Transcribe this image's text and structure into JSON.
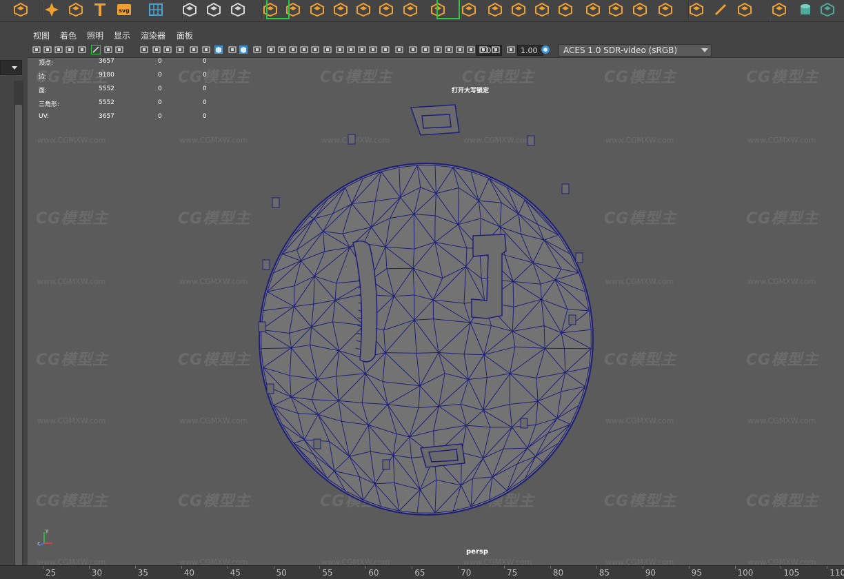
{
  "panel_menu": [
    "视图",
    "着色",
    "照明",
    "显示",
    "渲染器",
    "面板"
  ],
  "toolbar": {
    "exposure_value": "0.00",
    "gamma_value": "1.00",
    "color_space": "ACES 1.0 SDR-video (sRGB)"
  },
  "shelf_icons": [
    "polygon-sphere-icon",
    "sweep-star-icon",
    "helix-icon",
    "type-text-icon",
    "svg-icon",
    "grid-icon",
    "measure-icon",
    "align-icon",
    "snap-coords-icon",
    "sculpt-icon",
    "layers-icon",
    "combine-icon",
    "separate-icon",
    "extract-icon",
    "smooth-icon",
    "boolean-icon",
    "mirror-icon",
    "bevel-icon",
    "extrude-icon",
    "bridge-icon",
    "fill-hole-icon",
    "merge-icon",
    "split-icon",
    "multi-cut-icon",
    "target-weld-icon",
    "edge-loop-icon",
    "uv-icon",
    "pencil-icon",
    "crease-icon",
    "paint-icon",
    "cylinder-icon",
    "cube-icon"
  ],
  "hud": {
    "rows": [
      {
        "label": "顶点:",
        "v1": "3657",
        "v2": "0",
        "v3": "0"
      },
      {
        "label": "边:",
        "v1": "9180",
        "v2": "0",
        "v3": "0"
      },
      {
        "label": "面:",
        "v1": "5552",
        "v2": "0",
        "v3": "0"
      },
      {
        "label": "三角形:",
        "v1": "5552",
        "v2": "0",
        "v3": "0"
      },
      {
        "label": "UV:",
        "v1": "3657",
        "v2": "0",
        "v3": "0"
      }
    ],
    "caps_lock_message": "打开大写锁定",
    "camera": "persp"
  },
  "axis": {
    "y": "y",
    "x": "x",
    "z": "z"
  },
  "watermark": {
    "logo": "CG模型主",
    "url": "www.CGMXW.com"
  },
  "timeline": {
    "ticks": [
      "25",
      "30",
      "35",
      "40",
      "45",
      "50",
      "55",
      "60",
      "65",
      "70",
      "75",
      "80",
      "85",
      "90",
      "95",
      "100",
      "105",
      "110"
    ]
  },
  "colors": {
    "wireframe": "#1f1f7a",
    "viewport_bg": "#5b5b5b",
    "shelf_accent": "#f0a030",
    "shelf_teal": "#4fa89a",
    "active_green": "#27c93f"
  }
}
